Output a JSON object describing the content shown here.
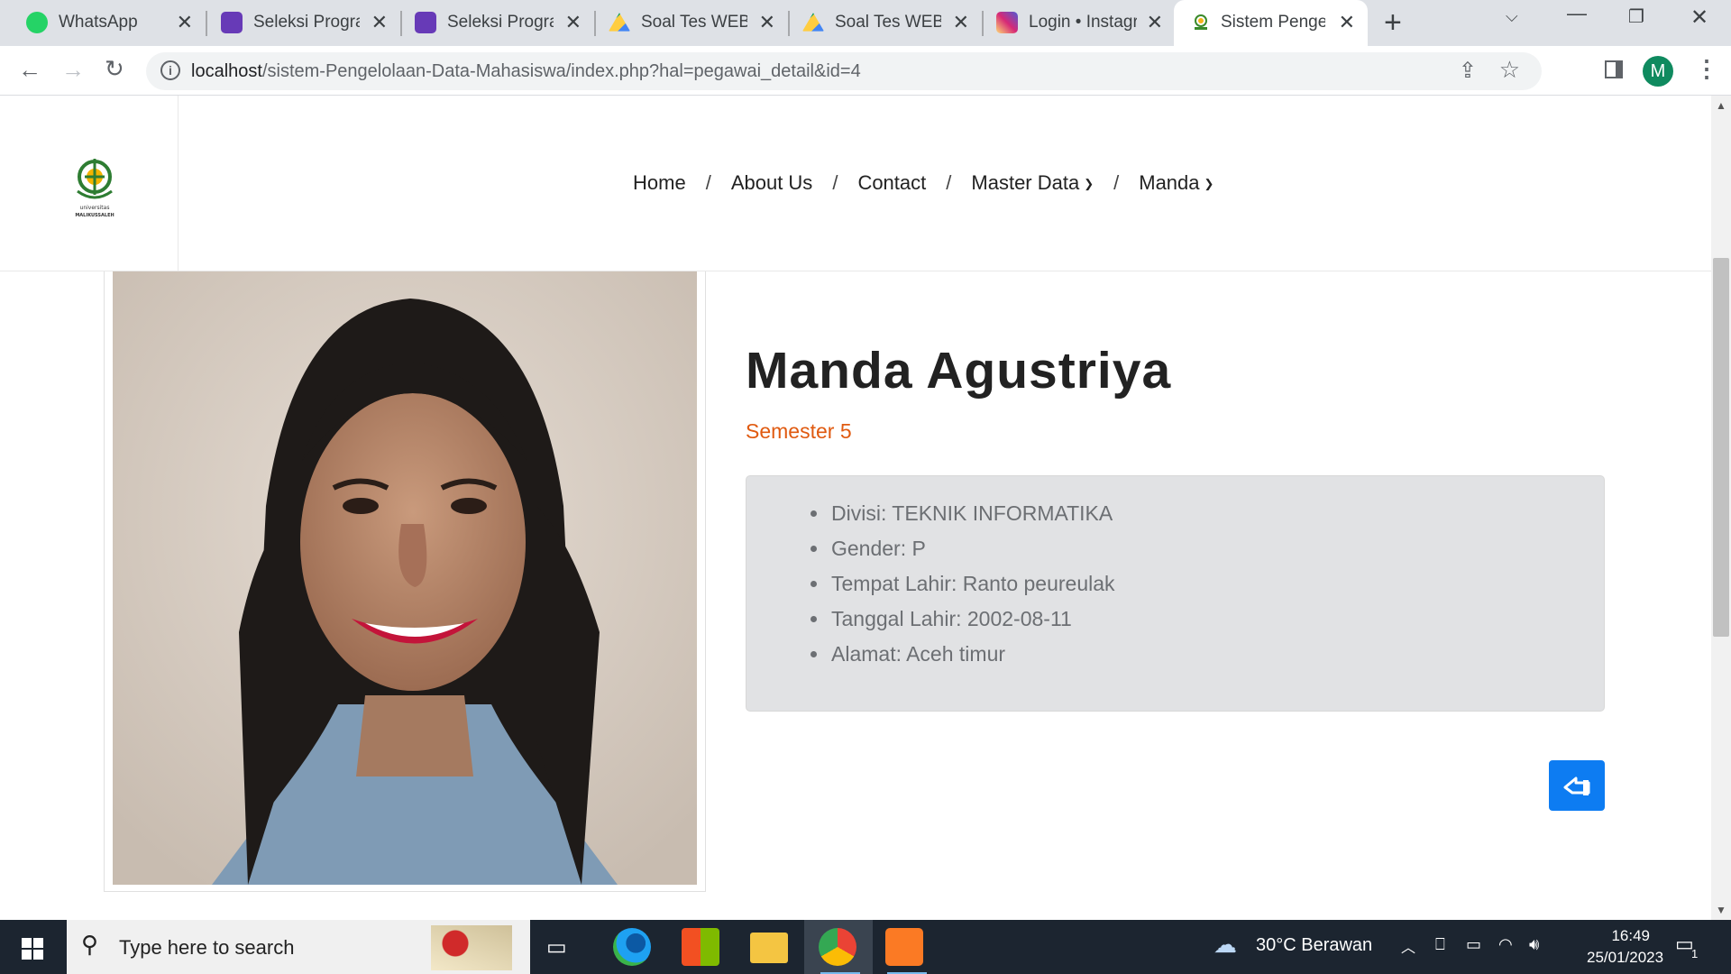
{
  "browser": {
    "tabs": [
      {
        "title": "WhatsApp",
        "active": false
      },
      {
        "title": "Seleksi Program",
        "active": false
      },
      {
        "title": "Seleksi Program",
        "active": false
      },
      {
        "title": "Soal Tes WEB D",
        "active": false
      },
      {
        "title": "Soal Tes WEB D",
        "active": false
      },
      {
        "title": "Login • Instagram",
        "active": false
      },
      {
        "title": "Sistem Pengelola",
        "active": true
      }
    ],
    "url_host": "localhost",
    "url_path": "/sistem-Pengelolaan-Data-Mahasiswa/index.php?hal=pegawai_detail&id=4",
    "profile_initial": "M"
  },
  "nav": {
    "items": [
      "Home",
      "About Us",
      "Contact",
      "Master Data",
      "Manda"
    ],
    "separator": "/"
  },
  "profile": {
    "name": "Manda Agustriya",
    "semester": "Semester 5",
    "details": [
      "Divisi: TEKNIK INFORMATIKA",
      "Gender: P",
      "Tempat Lahir: Ranto peureulak",
      "Tanggal Lahir: 2002-08-11",
      "Alamat: Aceh timur"
    ]
  },
  "logo": {
    "line1": "universitas",
    "line2": "MALIKUSSALEH"
  },
  "taskbar": {
    "search_placeholder": "Type here to search",
    "weather": "30°C  Berawan",
    "time": "16:49",
    "date": "25/01/2023",
    "notification_count": "1"
  },
  "colors": {
    "accent": "#0d7cf2",
    "semester": "#e05a10",
    "infobox": "#e1e2e4"
  }
}
